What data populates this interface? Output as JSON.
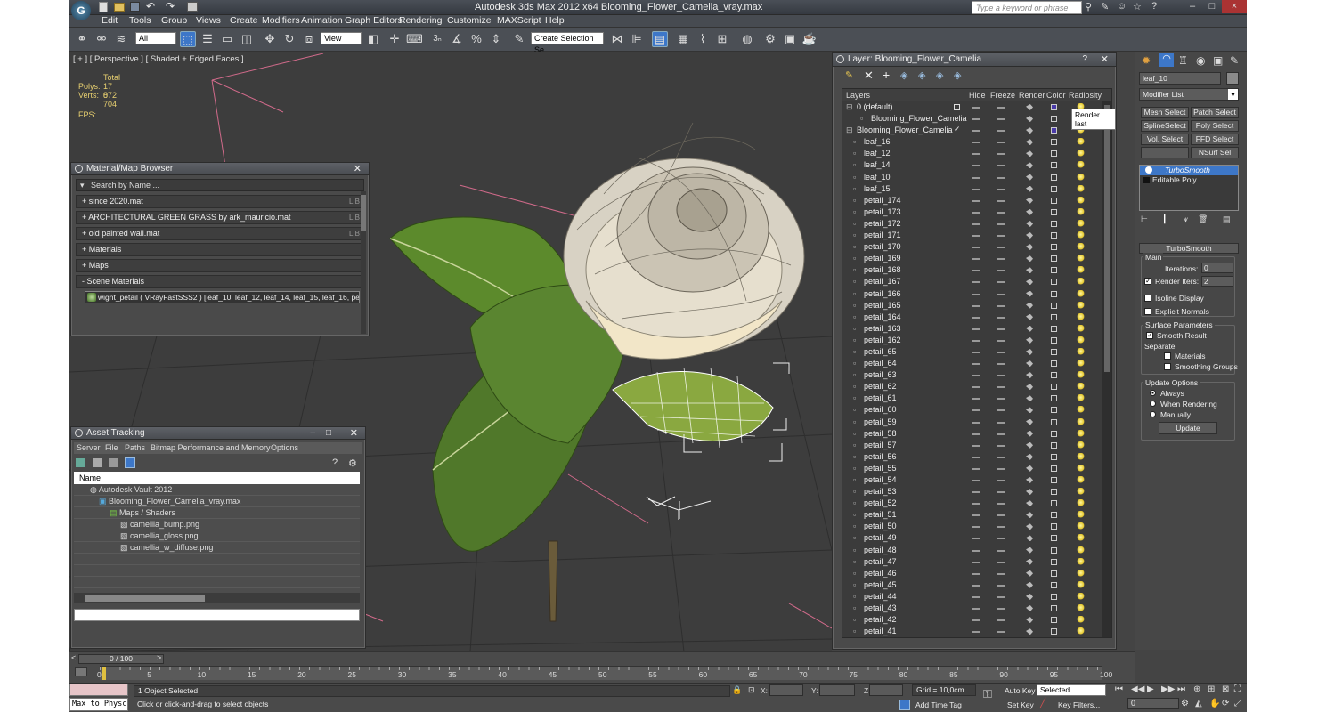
{
  "app": {
    "title": "Autodesk 3ds Max  2012 x64     Blooming_Flower_Camelia_vray.max",
    "search_placeholder": "Type a keyword or phrase"
  },
  "menu": [
    "Edit",
    "Tools",
    "Group",
    "Views",
    "Create",
    "Modifiers",
    "Animation",
    "Graph Editors",
    "Rendering",
    "Customize",
    "MAXScript",
    "Help"
  ],
  "toolbar": {
    "selection_filter": "All",
    "ref_coord": "View",
    "named_selection": "Create Selection Se"
  },
  "viewport": {
    "label": "[ + ] [ Perspective ] [ Shaded + Edged Faces ]",
    "stats_total": "Total",
    "polys_label": "Polys:",
    "polys_value": "17 072",
    "verts_label": "Verts:",
    "verts_value": "8 704",
    "fps_label": "FPS:"
  },
  "material_browser": {
    "title": "Material/Map Browser",
    "search": "Search by Name ...",
    "rows": [
      {
        "label": "+ since 2020.mat",
        "lib": "LIB"
      },
      {
        "label": "+ ARCHITECTURAL GREEN GRASS by ark_mauricio.mat",
        "lib": "LIB"
      },
      {
        "label": "+ old painted wall.mat",
        "lib": "LIB"
      },
      {
        "label": "+ Materials",
        "lib": ""
      },
      {
        "label": "+ Maps",
        "lib": ""
      },
      {
        "label": "- Scene Materials",
        "lib": ""
      }
    ],
    "scene_material": "wight_petail  ( VRayFastSSS2 )  [leaf_10, leaf_12, leaf_14, leaf_15, leaf_16, peta..."
  },
  "asset_tracking": {
    "title": "Asset Tracking",
    "menu": [
      "Server",
      "File",
      "Paths",
      "Bitmap Performance and Memory",
      "Options"
    ],
    "column": "Name",
    "rows": [
      "Autodesk Vault 2012",
      "Blooming_Flower_Camelia_vray.max",
      "Maps / Shaders",
      "camellia_bump.png",
      "camellia_gloss.png",
      "camellia_w_diffuse.png"
    ]
  },
  "layer_window": {
    "title": "Layer: Blooming_Flower_Camelia",
    "columns": [
      "Layers",
      "Hide",
      "Freeze",
      "Render",
      "Color",
      "Radiosity"
    ],
    "tooltip": "Render last",
    "rows": [
      "0 (default)",
      "Blooming_Flower_Camelia",
      "Blooming_Flower_Camelia",
      "leaf_16",
      "leaf_12",
      "leaf_14",
      "leaf_10",
      "leaf_15",
      "petail_174",
      "petail_173",
      "petail_172",
      "petail_171",
      "petail_170",
      "petail_169",
      "petail_168",
      "petail_167",
      "petail_166",
      "petail_165",
      "petail_164",
      "petail_163",
      "petail_162",
      "petail_65",
      "petail_64",
      "petail_63",
      "petail_62",
      "petail_61",
      "petail_60",
      "petail_59",
      "petail_58",
      "petail_57",
      "petail_56",
      "petail_55",
      "petail_54",
      "petail_53",
      "petail_52",
      "petail_51",
      "petail_50",
      "petail_49",
      "petail_48",
      "petail_47",
      "petail_46",
      "petail_45",
      "petail_44",
      "petail_43",
      "petail_42",
      "petail_41"
    ]
  },
  "command_panel": {
    "object_name": "leaf_10",
    "modifier_list": "Modifier List",
    "buttons": [
      "Mesh Select",
      "Patch Select",
      "SplineSelect",
      "Poly Select",
      "Vol. Select",
      "FFD Select",
      "NSurf Sel"
    ],
    "stack": [
      "TurboSmooth",
      "Editable Poly"
    ],
    "rollout_title": "TurboSmooth",
    "main_label": "Main",
    "iterations_label": "Iterations:",
    "iterations": "0",
    "render_iters_label": "Render Iters:",
    "render_iters": "2",
    "isoline": "Isoline Display",
    "explicit": "Explicit Normals",
    "surface_params": "Surface Parameters",
    "smooth_result": "Smooth Result",
    "separate": "Separate",
    "materials": "Materials",
    "smoothing_groups": "Smoothing Groups",
    "update_options": "Update Options",
    "always": "Always",
    "when_rendering": "When Rendering",
    "manually": "Manually",
    "update": "Update"
  },
  "timeline": {
    "frame": "0 / 100",
    "ticks": [
      "0",
      "5",
      "10",
      "15",
      "20",
      "25",
      "30",
      "35",
      "40",
      "45",
      "50",
      "55",
      "60",
      "65",
      "70",
      "75",
      "80",
      "85",
      "90",
      "95",
      "100"
    ]
  },
  "status": {
    "maxscript": "Max to Physc",
    "selected": "1 Object Selected",
    "prompt": "Click or click-and-drag to select objects",
    "x_label": "X:",
    "y_label": "Y:",
    "z_label": "Z:",
    "grid": "Grid = 10,0cm",
    "add_time_tag": "Add Time Tag",
    "auto_key": "Auto Key",
    "set_key": "Set Key",
    "key_mode": "Selected",
    "key_filters": "Key Filters...",
    "frame_field": "0"
  }
}
